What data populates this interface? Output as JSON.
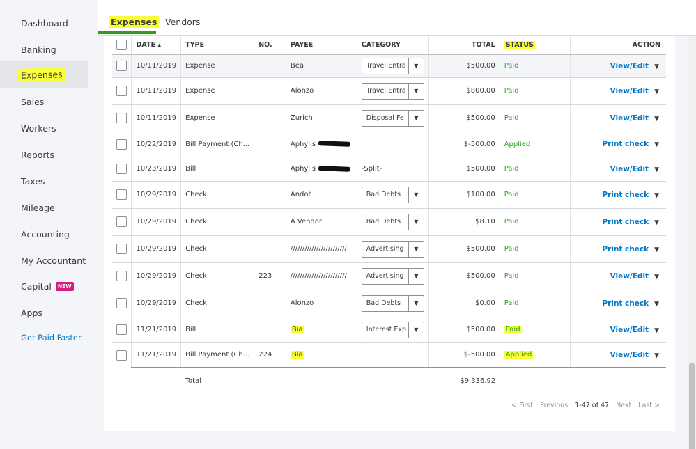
{
  "sidebar": {
    "items": [
      {
        "label": "Dashboard"
      },
      {
        "label": "Banking"
      },
      {
        "label": "Expenses"
      },
      {
        "label": "Sales"
      },
      {
        "label": "Workers"
      },
      {
        "label": "Reports"
      },
      {
        "label": "Taxes"
      },
      {
        "label": "Mileage"
      },
      {
        "label": "Accounting"
      },
      {
        "label": "My Accountant"
      },
      {
        "label": "Capital",
        "badge": "NEW"
      },
      {
        "label": "Apps"
      }
    ],
    "get_paid_faster": "Get Paid Faster"
  },
  "tabs": [
    {
      "label": "Expenses"
    },
    {
      "label": "Vendors"
    }
  ],
  "table": {
    "headers": {
      "date": "DATE",
      "type": "TYPE",
      "no": "NO.",
      "payee": "PAYEE",
      "category": "CATEGORY",
      "total": "TOTAL",
      "status": "STATUS",
      "action": "ACTION"
    },
    "rows": [
      {
        "date": "10/11/2019",
        "type": "Expense",
        "no": "",
        "payee": "Bea",
        "category": "Travel:Entra",
        "total": "$500.00",
        "status": "Paid",
        "action": "View/Edit"
      },
      {
        "date": "10/11/2019",
        "type": "Expense",
        "no": "",
        "payee": "Alonzo",
        "category": "Travel:Entra",
        "total": "$800.00",
        "status": "Paid",
        "action": "View/Edit"
      },
      {
        "date": "10/11/2019",
        "type": "Expense",
        "no": "",
        "payee": "Zurich",
        "category": "Disposal Fe",
        "total": "$500.00",
        "status": "Paid",
        "action": "View/Edit"
      },
      {
        "date": "10/22/2019",
        "type": "Bill Payment (Ch...",
        "no": "",
        "payee": "Aphylis",
        "category": "",
        "total": "$-500.00",
        "status": "Applied",
        "action": "Print check"
      },
      {
        "date": "10/23/2019",
        "type": "Bill",
        "no": "",
        "payee": "Aphylis",
        "category": "-Split-",
        "total": "$500.00",
        "status": "Paid",
        "action": "View/Edit"
      },
      {
        "date": "10/29/2019",
        "type": "Check",
        "no": "",
        "payee": "Andot",
        "category": "Bad Debts",
        "total": "$100.00",
        "status": "Paid",
        "action": "Print check"
      },
      {
        "date": "10/29/2019",
        "type": "Check",
        "no": "",
        "payee": "A Vendor",
        "category": "Bad Debts",
        "total": "$8.10",
        "status": "Paid",
        "action": "Print check"
      },
      {
        "date": "10/29/2019",
        "type": "Check",
        "no": "",
        "payee": "////////////////////////",
        "category": "Advertising",
        "total": "$500.00",
        "status": "Paid",
        "action": "Print check"
      },
      {
        "date": "10/29/2019",
        "type": "Check",
        "no": "223",
        "payee": "////////////////////////",
        "category": "Advertising",
        "total": "$500.00",
        "status": "Paid",
        "action": "View/Edit"
      },
      {
        "date": "10/29/2019",
        "type": "Check",
        "no": "",
        "payee": "Alonzo",
        "category": "Bad Debts",
        "total": "$0.00",
        "status": "Paid",
        "action": "Print check"
      },
      {
        "date": "11/21/2019",
        "type": "Bill",
        "no": "",
        "payee": "Bia",
        "category": "Interest Exp",
        "total": "$500.00",
        "status": "Paid",
        "action": "View/Edit"
      },
      {
        "date": "11/21/2019",
        "type": "Bill Payment (Ch...",
        "no": "224",
        "payee": "Bia",
        "category": "",
        "total": "$-500.00",
        "status": "Applied",
        "action": "View/Edit"
      }
    ],
    "total_label": "Total",
    "total_value": "$9,336.92"
  },
  "pagination": {
    "first": "< First",
    "previous": "Previous",
    "range": "1-47 of 47",
    "next": "Next",
    "last": "Last >"
  },
  "colors": {
    "highlight": "#fbff3a",
    "status_green": "#2ca01c",
    "link_blue": "#0077c5",
    "tab_underline": "#2ca01c",
    "badge_pink": "#d11f7a"
  }
}
